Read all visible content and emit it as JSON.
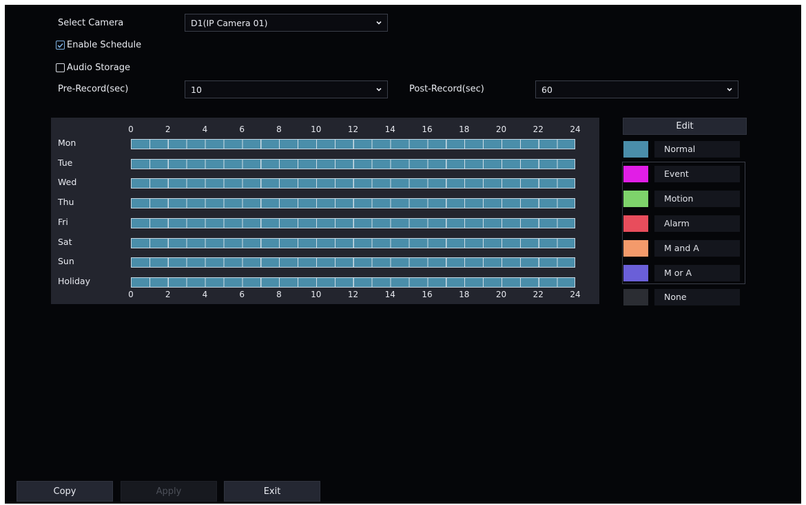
{
  "form": {
    "select_camera_label": "Select Camera",
    "camera_value": "D1(IP Camera 01)",
    "enable_schedule_label": "Enable Schedule",
    "enable_schedule_checked": true,
    "audio_storage_label": "Audio Storage",
    "audio_storage_checked": false,
    "pre_record_label": "Pre-Record(sec)",
    "pre_record_value": "10",
    "post_record_label": "Post-Record(sec)",
    "post_record_value": "60"
  },
  "schedule": {
    "hours": [
      "0",
      "2",
      "4",
      "6",
      "8",
      "10",
      "12",
      "14",
      "16",
      "18",
      "20",
      "22",
      "24"
    ],
    "days": [
      {
        "label": "Mon",
        "type": "Normal",
        "start": 0,
        "end": 24
      },
      {
        "label": "Tue",
        "type": "Normal",
        "start": 0,
        "end": 24
      },
      {
        "label": "Wed",
        "type": "Normal",
        "start": 0,
        "end": 24
      },
      {
        "label": "Thu",
        "type": "Normal",
        "start": 0,
        "end": 24
      },
      {
        "label": "Fri",
        "type": "Normal",
        "start": 0,
        "end": 24
      },
      {
        "label": "Sat",
        "type": "Normal",
        "start": 0,
        "end": 24
      },
      {
        "label": "Sun",
        "type": "Normal",
        "start": 0,
        "end": 24
      },
      {
        "label": "Holiday",
        "type": "Normal",
        "start": 0,
        "end": 24
      }
    ]
  },
  "legend": {
    "edit_label": "Edit",
    "items": [
      {
        "label": "Normal",
        "color": "#4a8eaa"
      },
      {
        "label": "Event",
        "color": "#e11ee6"
      },
      {
        "label": "Motion",
        "color": "#7ed36b"
      },
      {
        "label": "Alarm",
        "color": "#e84d5c"
      },
      {
        "label": "M and A",
        "color": "#f49a6b"
      },
      {
        "label": "M or A",
        "color": "#6a5fd8"
      },
      {
        "label": "None",
        "color": "#2b2d33"
      }
    ]
  },
  "footer": {
    "copy_label": "Copy",
    "apply_label": "Apply",
    "exit_label": "Exit"
  }
}
